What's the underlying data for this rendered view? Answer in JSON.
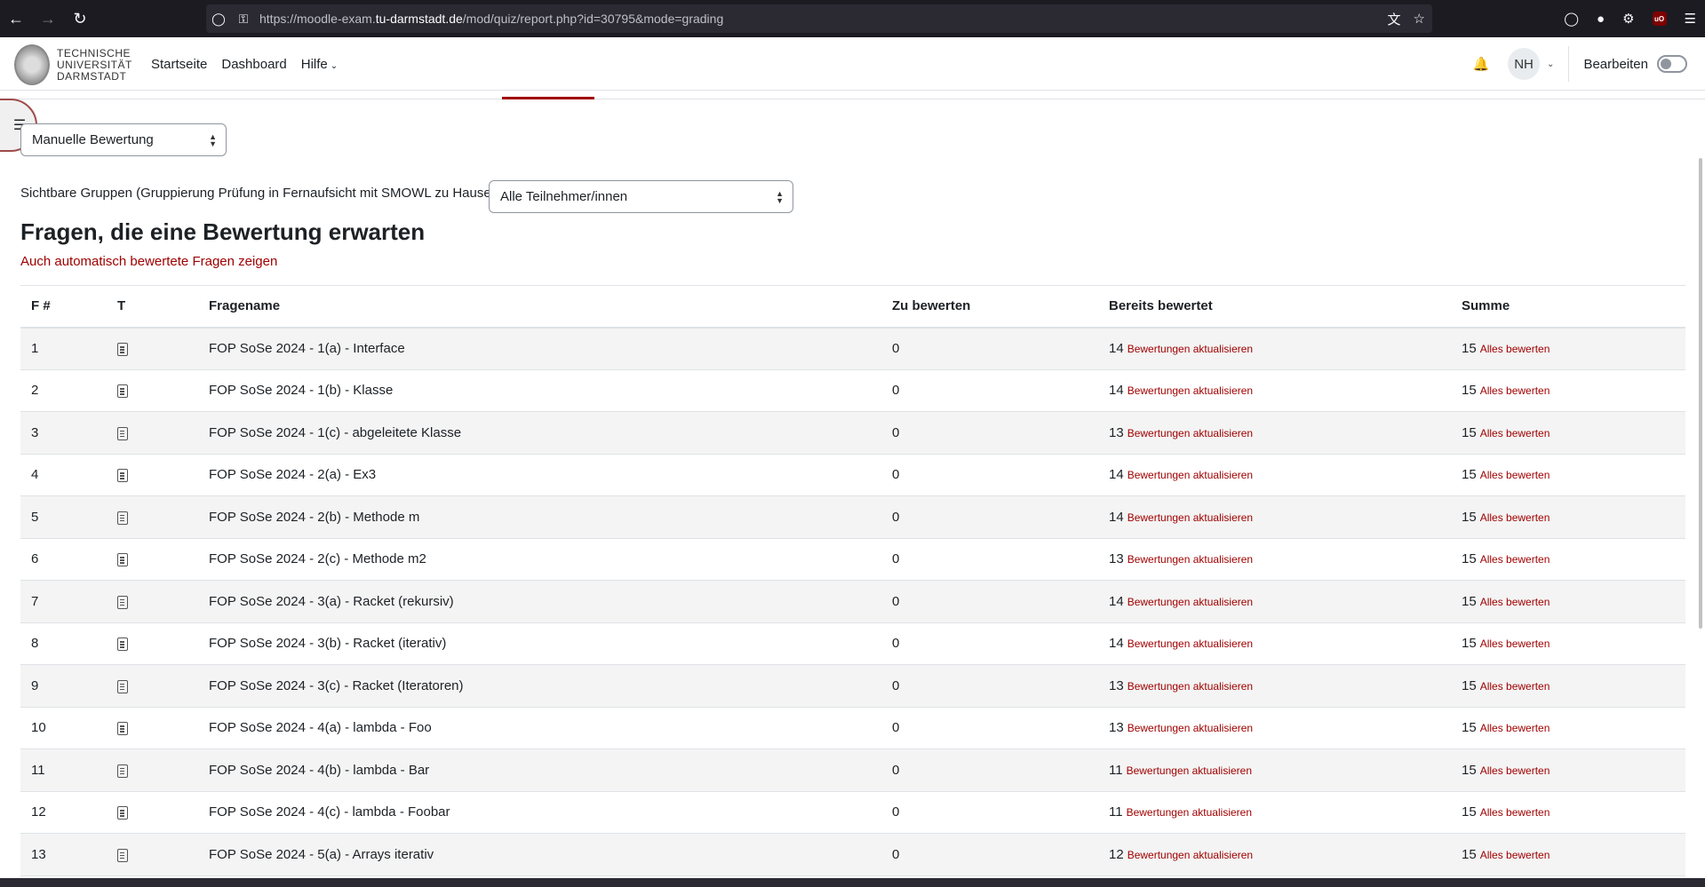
{
  "browser": {
    "url_prefix": "https://moodle-exam.",
    "url_domain": "tu-darmstadt.de",
    "url_path": "/mod/quiz/report.php?id=30795&mode=grading"
  },
  "navbar": {
    "logo_line1": "TECHNISCHE",
    "logo_line2": "UNIVERSITÄT",
    "logo_line3": "DARMSTADT",
    "home": "Startseite",
    "dashboard": "Dashboard",
    "help": "Hilfe",
    "avatar_initials": "NH",
    "edit_mode": "Bearbeiten"
  },
  "report_select": {
    "value": "Manuelle Bewertung"
  },
  "groups": {
    "label": "Sichtbare Gruppen (Gruppierung Prüfung in Fernaufsicht mit SMOWL zu Hause)",
    "value": "Alle Teilnehmer/innen"
  },
  "page_title": "Fragen, die eine Bewertung erwarten",
  "show_auto_link": "Auch automatisch bewertete Fragen zeigen",
  "table": {
    "headers": {
      "num": "F #",
      "type": "T",
      "name": "Fragename",
      "todo": "Zu bewerten",
      "done": "Bereits bewertet",
      "total": "Summe"
    },
    "regrade_label": "Bewertungen aktualisieren",
    "grade_all_label": "Alles bewerten",
    "rows": [
      {
        "num": "1",
        "name": "FOP SoSe 2024 - 1(a) - Interface",
        "todo": "0",
        "done": "14",
        "total": "15"
      },
      {
        "num": "2",
        "name": "FOP SoSe 2024 - 1(b) - Klasse",
        "todo": "0",
        "done": "14",
        "total": "15"
      },
      {
        "num": "3",
        "name": "FOP SoSe 2024 - 1(c) - abgeleitete Klasse",
        "todo": "0",
        "done": "13",
        "total": "15"
      },
      {
        "num": "4",
        "name": "FOP SoSe 2024 - 2(a) - Ex3",
        "todo": "0",
        "done": "14",
        "total": "15"
      },
      {
        "num": "5",
        "name": "FOP SoSe 2024 - 2(b) - Methode m",
        "todo": "0",
        "done": "14",
        "total": "15"
      },
      {
        "num": "6",
        "name": "FOP SoSe 2024 - 2(c) - Methode m2",
        "todo": "0",
        "done": "13",
        "total": "15"
      },
      {
        "num": "7",
        "name": "FOP SoSe 2024 - 3(a) - Racket (rekursiv)",
        "todo": "0",
        "done": "14",
        "total": "15"
      },
      {
        "num": "8",
        "name": "FOP SoSe 2024 - 3(b) - Racket (iterativ)",
        "todo": "0",
        "done": "14",
        "total": "15"
      },
      {
        "num": "9",
        "name": "FOP SoSe 2024 - 3(c) - Racket (Iteratoren)",
        "todo": "0",
        "done": "13",
        "total": "15"
      },
      {
        "num": "10",
        "name": "FOP SoSe 2024 - 4(a) - lambda - Foo",
        "todo": "0",
        "done": "13",
        "total": "15"
      },
      {
        "num": "11",
        "name": "FOP SoSe 2024 - 4(b) - lambda - Bar",
        "todo": "0",
        "done": "11",
        "total": "15"
      },
      {
        "num": "12",
        "name": "FOP SoSe 2024 - 4(c) - lambda - Foobar",
        "todo": "0",
        "done": "11",
        "total": "15"
      },
      {
        "num": "13",
        "name": "FOP SoSe 2024 - 5(a) - Arrays iterativ",
        "todo": "0",
        "done": "12",
        "total": "15"
      }
    ]
  },
  "colors": {
    "accent": "#a00000",
    "chrome_bg": "#1c1b22"
  }
}
